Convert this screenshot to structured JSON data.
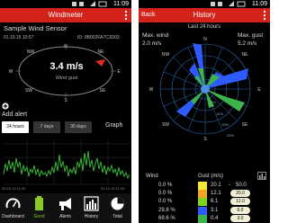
{
  "left": {
    "status": {
      "time": "11:09"
    },
    "app_title": "Windmeter",
    "back_label": "",
    "sensor_name": "Sample Wind Sensor",
    "sensor_date": "01.10.15  10:57",
    "sensor_id": "ID: 0B002FA7C3D03",
    "compass": {
      "n": "N",
      "ne": "NE",
      "e": "E",
      "se": "SE",
      "s": "S",
      "sw": "SW",
      "w": "W",
      "nw": "NW",
      "speed": "3.4 m/s",
      "gust_label": "Wind gust"
    },
    "add_alert": "Add alert",
    "tabs": [
      {
        "label": "24 hours",
        "active": true
      },
      {
        "label": "7 days",
        "active": false
      },
      {
        "label": "30 days",
        "active": false
      }
    ],
    "graph_label": "Graph",
    "date_start": "30.09.15 11:00",
    "date_end": "01.10.15 11:00",
    "nav": [
      {
        "label": "Dashboard",
        "icon": "gauge-icon",
        "active": false
      },
      {
        "label": "Good",
        "icon": "battery-icon",
        "active": true
      },
      {
        "label": "Alerts",
        "icon": "megaphone-icon",
        "active": false
      },
      {
        "label": "History",
        "icon": "history-icon",
        "active": false
      },
      {
        "label": "Total",
        "icon": "pie-chart-icon",
        "active": false
      }
    ]
  },
  "right": {
    "status": {
      "time": "11:09"
    },
    "app_title": "History",
    "back_label": "Back",
    "last24": "Last 24 hours",
    "max_wind_label": "Max. wind",
    "max_wind_value": "2.0  m/s",
    "max_gust_label": "Max. gust",
    "max_gust_value": "5.2  m/s",
    "compass": {
      "n": "N",
      "ne": "NE",
      "e": "E",
      "se": "SE",
      "s": "S",
      "sw": "SW",
      "w": "W",
      "nw": "NW"
    },
    "ring_labels": [
      "5%",
      "10%",
      "15%",
      "20%"
    ],
    "legend_wind": "Wind",
    "legend_gust": "Gust (m/s)",
    "legend": [
      {
        "pct": "0.0 %",
        "color": "#f2e83a",
        "lower": "20.1",
        "upper": "50.0",
        "badge": false
      },
      {
        "pct": "0.0 %",
        "color": "#f5a623",
        "lower": "12.1",
        "upper": "20.0",
        "badge": true
      },
      {
        "pct": "0.0 %",
        "color": "#7ed321",
        "lower": "6.1",
        "upper": "12.0",
        "badge": true
      },
      {
        "pct": "29.8 %",
        "color": "#2d5bff",
        "lower": "3.1",
        "upper": "6.0",
        "badge": true
      },
      {
        "pct": "69.6 %",
        "color": "#3cb44b",
        "lower": "0.4",
        "upper": "3.0",
        "badge": true
      },
      {
        "pct": "0.5 %",
        "color": "#4a90e2",
        "lower": "0",
        "upper": "0.3",
        "badge": true
      }
    ]
  },
  "colors": {
    "accent_red": "#d2221a",
    "good_green": "#8ac926",
    "series_green": "#37c837"
  }
}
